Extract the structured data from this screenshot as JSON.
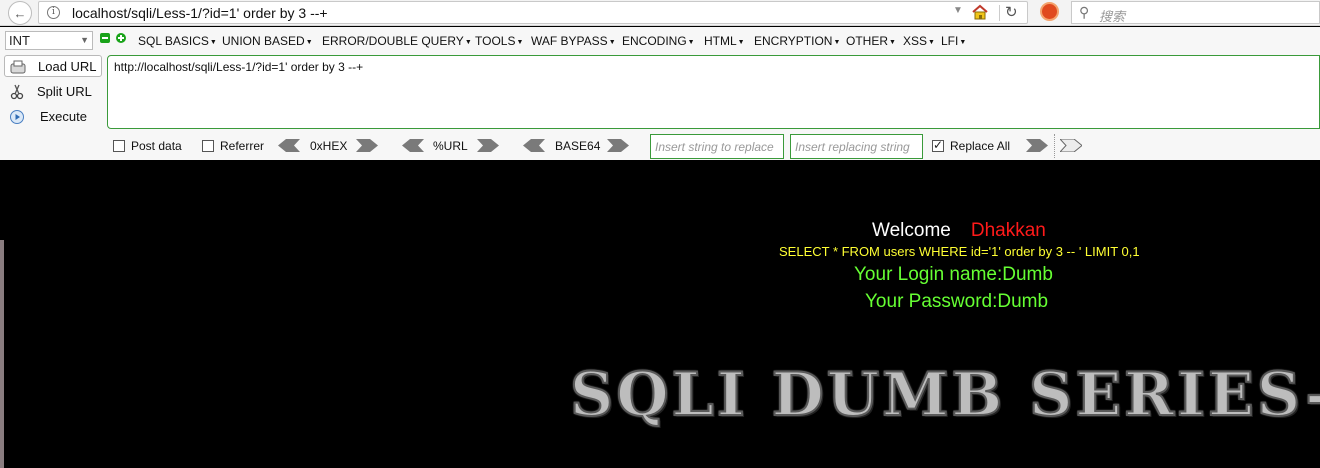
{
  "browser": {
    "url": "localhost/sqli/Less-1/?id=1' order by 3 --+",
    "search_placeholder": "搜索"
  },
  "hackbar": {
    "type_select": "INT",
    "menus": [
      "SQL BASICS",
      "UNION BASED",
      "ERROR/DOUBLE QUERY",
      "TOOLS",
      "WAF BYPASS",
      "ENCODING",
      "HTML",
      "ENCRYPTION",
      "OTHER",
      "XSS",
      "LFI"
    ],
    "load_url_label": "Load URL",
    "split_url_label": "Split URL",
    "execute_label": "Execute",
    "url_value": "http://localhost/sqli/Less-1/?id=1' order by 3 --+",
    "post_data_label": "Post data",
    "referrer_label": "Referrer",
    "hex_label": "0xHEX",
    "url_enc_label": "%URL",
    "base64_label": "BASE64",
    "replace_from_placeholder": "Insert string to replace",
    "replace_to_placeholder": "Insert replacing string",
    "replace_all_label": "Replace All",
    "post_data_checked": false,
    "referrer_checked": false,
    "replace_all_checked": true
  },
  "page": {
    "welcome": "Welcome",
    "user": "Dhakkan",
    "query": "SELECT * FROM users WHERE id='1' order by 3 -- ' LIMIT 0,1",
    "login_name": "Your Login name:Dumb",
    "password": "Your Password:Dumb",
    "banner": "SQLI DUMB SERIES-"
  },
  "colors": {
    "welcome": "#ffffff",
    "user": "#ff1a1a",
    "query": "#ffff33",
    "login": "#66ff33",
    "accent_green": "#3a9a3a"
  }
}
